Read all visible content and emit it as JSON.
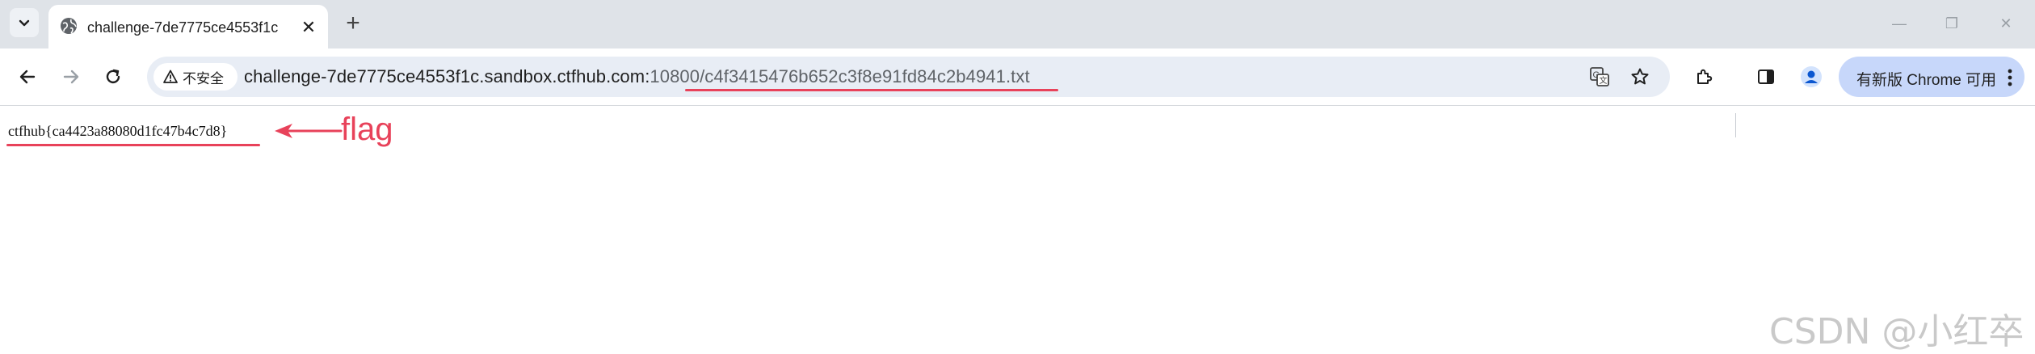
{
  "tab": {
    "title": "challenge-7de7775ce4553f1c",
    "close_glyph": "✕"
  },
  "new_tab_glyph": "+",
  "window_controls": {
    "minimize": "—",
    "restore": "❐",
    "close": "✕"
  },
  "omnibox": {
    "security_label": "不安全",
    "url_host": "challenge-7de7775ce4553f1c.sandbox.ctfhub.com:",
    "url_path": "10800/c4f3415476b652c3f8e91fd84c2b4941.txt"
  },
  "toolbar": {
    "update_button_label": "有新版 Chrome 可用"
  },
  "page": {
    "flag_text": "ctfhub{ca4423a88080d1fc47b4c7d8}",
    "annotation_label": "flag",
    "watermark": "CSDN @小红卒"
  },
  "colors": {
    "annotation": "#e8425a",
    "tabstrip": "#dfe3e8",
    "omnibox": "#e8edf5",
    "update_button": "#c7d7fa"
  },
  "icons": [
    "tab-search-icon",
    "globe-icon",
    "back-icon",
    "forward-icon",
    "reload-icon",
    "warning-icon",
    "translate-icon",
    "star-icon",
    "extensions-icon",
    "side-panel-icon",
    "profile-icon",
    "more-icon"
  ]
}
